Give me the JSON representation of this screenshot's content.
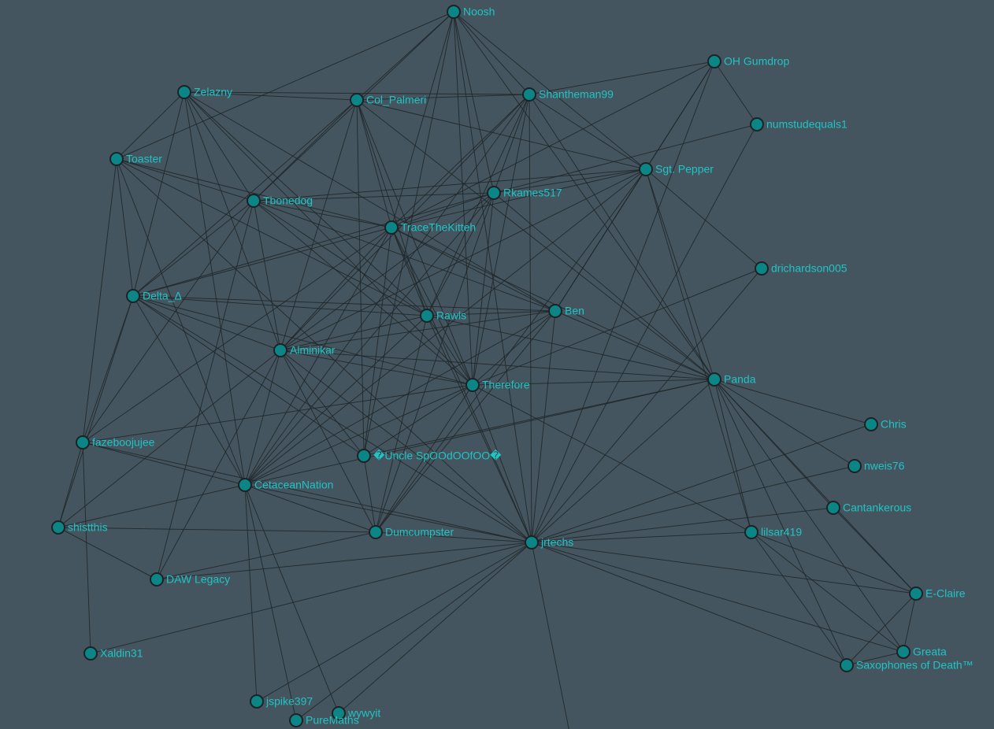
{
  "graph": {
    "node_color": "#0b8585",
    "label_color": "#1fc4c4",
    "edge_color": "#1e2628",
    "background": "#45555f",
    "nodes": [
      {
        "id": "Noosh",
        "label": "Noosh"
      },
      {
        "id": "OH Gumdrop",
        "label": "OH Gumdrop"
      },
      {
        "id": "numstudequals1",
        "label": "numstudequals1"
      },
      {
        "id": "Zelazny",
        "label": "Zelazny"
      },
      {
        "id": "Col_Palmeri",
        "label": "Col_Palmeri"
      },
      {
        "id": "Shantheman99",
        "label": "Shantheman99"
      },
      {
        "id": "Toaster",
        "label": "Toaster"
      },
      {
        "id": "Sgt. Pepper",
        "label": "Sgt. Pepper"
      },
      {
        "id": "Tbonedog",
        "label": "Tbonedog"
      },
      {
        "id": "Rkames517",
        "label": "Rkames517"
      },
      {
        "id": "TraceTheKitteh",
        "label": "TraceTheKitteh"
      },
      {
        "id": "drichardson005",
        "label": "drichardson005"
      },
      {
        "id": "Delta_Δ",
        "label": "Delta_Δ"
      },
      {
        "id": "Rawls",
        "label": "Rawls"
      },
      {
        "id": "Ben",
        "label": "Ben"
      },
      {
        "id": "Alminikar",
        "label": "Alminikar"
      },
      {
        "id": "Panda",
        "label": "Panda"
      },
      {
        "id": "Therefore",
        "label": "Therefore"
      },
      {
        "id": "Chris",
        "label": "Chris"
      },
      {
        "id": "fazeboojujee",
        "label": "fazeboojujee"
      },
      {
        "id": "Uncle SpOOdOOfOO",
        "label": "�Uncle SpOOdOOfOO�"
      },
      {
        "id": "nweis76",
        "label": "nweis76"
      },
      {
        "id": "CetaceanNation",
        "label": "CetaceanNation"
      },
      {
        "id": "Cantankerous",
        "label": "Cantankerous"
      },
      {
        "id": "shistthis",
        "label": "shistthis"
      },
      {
        "id": "Dumcumpster",
        "label": "Dumcumpster"
      },
      {
        "id": "lilsar419",
        "label": "lilsar419"
      },
      {
        "id": "jrtechs",
        "label": "jrtechs"
      },
      {
        "id": "DAW Legacy",
        "label": "DAW Legacy"
      },
      {
        "id": "E-Claire",
        "label": "E-Claire"
      },
      {
        "id": "Xaldin31",
        "label": "Xaldin31"
      },
      {
        "id": "Greata",
        "label": "Greata"
      },
      {
        "id": "Saxophones of Death™",
        "label": "Saxophones of Death™"
      },
      {
        "id": "jspike397",
        "label": "jspike397"
      },
      {
        "id": "wywyit",
        "label": "wywyit"
      },
      {
        "id": "PureMaths",
        "label": "PureMaths"
      }
    ],
    "edges": [
      [
        "Noosh",
        "Toaster"
      ],
      [
        "Noosh",
        "Col_Palmeri"
      ],
      [
        "Noosh",
        "Shantheman99"
      ],
      [
        "Noosh",
        "Sgt. Pepper"
      ],
      [
        "Noosh",
        "Rkames517"
      ],
      [
        "Noosh",
        "TraceTheKitteh"
      ],
      [
        "Noosh",
        "Therefore"
      ],
      [
        "Noosh",
        "Panda"
      ],
      [
        "Noosh",
        "jrtechs"
      ],
      [
        "Noosh",
        "Uncle SpOOdOOfOO"
      ],
      [
        "Noosh",
        "Tbonedog"
      ],
      [
        "OH Gumdrop",
        "Shantheman99"
      ],
      [
        "OH Gumdrop",
        "numstudequals1"
      ],
      [
        "OH Gumdrop",
        "Sgt. Pepper"
      ],
      [
        "OH Gumdrop",
        "TraceTheKitteh"
      ],
      [
        "OH Gumdrop",
        "Ben"
      ],
      [
        "OH Gumdrop",
        "jrtechs"
      ],
      [
        "numstudequals1",
        "Rkames517"
      ],
      [
        "numstudequals1",
        "jrtechs"
      ],
      [
        "Zelazny",
        "Col_Palmeri"
      ],
      [
        "Zelazny",
        "Shantheman99"
      ],
      [
        "Zelazny",
        "Toaster"
      ],
      [
        "Zelazny",
        "Tbonedog"
      ],
      [
        "Zelazny",
        "Delta_Δ"
      ],
      [
        "Zelazny",
        "Rawls"
      ],
      [
        "Zelazny",
        "Alminikar"
      ],
      [
        "Zelazny",
        "Therefore"
      ],
      [
        "Zelazny",
        "CetaceanNation"
      ],
      [
        "Zelazny",
        "Ben"
      ],
      [
        "Col_Palmeri",
        "Shantheman99"
      ],
      [
        "Col_Palmeri",
        "Sgt. Pepper"
      ],
      [
        "Col_Palmeri",
        "Tbonedog"
      ],
      [
        "Col_Palmeri",
        "TraceTheKitteh"
      ],
      [
        "Col_Palmeri",
        "Rawls"
      ],
      [
        "Col_Palmeri",
        "Alminikar"
      ],
      [
        "Col_Palmeri",
        "Therefore"
      ],
      [
        "Col_Palmeri",
        "Uncle SpOOdOOfOO"
      ],
      [
        "Col_Palmeri",
        "Panda"
      ],
      [
        "Col_Palmeri",
        "Delta_Δ"
      ],
      [
        "Shantheman99",
        "Sgt. Pepper"
      ],
      [
        "Shantheman99",
        "Rkames517"
      ],
      [
        "Shantheman99",
        "TraceTheKitteh"
      ],
      [
        "Shantheman99",
        "Panda"
      ],
      [
        "Shantheman99",
        "jrtechs"
      ],
      [
        "Shantheman99",
        "Alminikar"
      ],
      [
        "Shantheman99",
        "CetaceanNation"
      ],
      [
        "Shantheman99",
        "Therefore"
      ],
      [
        "Shantheman99",
        "Rawls"
      ],
      [
        "Toaster",
        "Tbonedog"
      ],
      [
        "Toaster",
        "TraceTheKitteh"
      ],
      [
        "Toaster",
        "Delta_Δ"
      ],
      [
        "Toaster",
        "CetaceanNation"
      ],
      [
        "Toaster",
        "Rawls"
      ],
      [
        "Toaster",
        "fazeboojujee"
      ],
      [
        "Toaster",
        "jrtechs"
      ],
      [
        "Sgt. Pepper",
        "Rkames517"
      ],
      [
        "Sgt. Pepper",
        "TraceTheKitteh"
      ],
      [
        "Sgt. Pepper",
        "Tbonedog"
      ],
      [
        "Sgt. Pepper",
        "drichardson005"
      ],
      [
        "Sgt. Pepper",
        "Ben"
      ],
      [
        "Sgt. Pepper",
        "Panda"
      ],
      [
        "Sgt. Pepper",
        "lilsar419"
      ],
      [
        "Sgt. Pepper",
        "CetaceanNation"
      ],
      [
        "Sgt. Pepper",
        "Alminikar"
      ],
      [
        "Sgt. Pepper",
        "Dumcumpster"
      ],
      [
        "Tbonedog",
        "Rkames517"
      ],
      [
        "Tbonedog",
        "TraceTheKitteh"
      ],
      [
        "Tbonedog",
        "Delta_Δ"
      ],
      [
        "Tbonedog",
        "Rawls"
      ],
      [
        "Tbonedog",
        "Ben"
      ],
      [
        "Tbonedog",
        "Alminikar"
      ],
      [
        "Tbonedog",
        "DAW Legacy"
      ],
      [
        "Tbonedog",
        "Therefore"
      ],
      [
        "Tbonedog",
        "fazeboojujee"
      ],
      [
        "Rkames517",
        "TraceTheKitteh"
      ],
      [
        "Rkames517",
        "Rawls"
      ],
      [
        "Rkames517",
        "Therefore"
      ],
      [
        "Rkames517",
        "Panda"
      ],
      [
        "Rkames517",
        "CetaceanNation"
      ],
      [
        "Rkames517",
        "Dumcumpster"
      ],
      [
        "Rkames517",
        "Alminikar"
      ],
      [
        "Rkames517",
        "Delta_Δ"
      ],
      [
        "TraceTheKitteh",
        "Delta_Δ"
      ],
      [
        "TraceTheKitteh",
        "Rawls"
      ],
      [
        "TraceTheKitteh",
        "Ben"
      ],
      [
        "TraceTheKitteh",
        "Therefore"
      ],
      [
        "TraceTheKitteh",
        "Alminikar"
      ],
      [
        "TraceTheKitteh",
        "CetaceanNation"
      ],
      [
        "TraceTheKitteh",
        "Uncle SpOOdOOfOO"
      ],
      [
        "TraceTheKitteh",
        "Panda"
      ],
      [
        "TraceTheKitteh",
        "fazeboojujee"
      ],
      [
        "TraceTheKitteh",
        "jrtechs"
      ],
      [
        "drichardson005",
        "Therefore"
      ],
      [
        "drichardson005",
        "jrtechs"
      ],
      [
        "Delta_Δ",
        "Rawls"
      ],
      [
        "Delta_Δ",
        "Ben"
      ],
      [
        "Delta_Δ",
        "Alminikar"
      ],
      [
        "Delta_Δ",
        "fazeboojujee"
      ],
      [
        "Delta_Δ",
        "CetaceanNation"
      ],
      [
        "Delta_Δ",
        "Uncle SpOOdOOfOO"
      ],
      [
        "Delta_Δ",
        "Therefore"
      ],
      [
        "Delta_Δ",
        "jrtechs"
      ],
      [
        "Rawls",
        "Ben"
      ],
      [
        "Rawls",
        "Therefore"
      ],
      [
        "Rawls",
        "Alminikar"
      ],
      [
        "Rawls",
        "CetaceanNation"
      ],
      [
        "Rawls",
        "Panda"
      ],
      [
        "Rawls",
        "Dumcumpster"
      ],
      [
        "Rawls",
        "jrtechs"
      ],
      [
        "Ben",
        "Panda"
      ],
      [
        "Ben",
        "Therefore"
      ],
      [
        "Ben",
        "CetaceanNation"
      ],
      [
        "Ben",
        "Alminikar"
      ],
      [
        "Ben",
        "Dumcumpster"
      ],
      [
        "Ben",
        "jrtechs"
      ],
      [
        "Alminikar",
        "Panda"
      ],
      [
        "Alminikar",
        "Therefore"
      ],
      [
        "Alminikar",
        "CetaceanNation"
      ],
      [
        "Alminikar",
        "Dumcumpster"
      ],
      [
        "Alminikar",
        "Uncle SpOOdOOfOO"
      ],
      [
        "Alminikar",
        "shistthis"
      ],
      [
        "Alminikar",
        "DAW Legacy"
      ],
      [
        "Alminikar",
        "jrtechs"
      ],
      [
        "Panda",
        "Therefore"
      ],
      [
        "Panda",
        "Chris"
      ],
      [
        "Panda",
        "nweis76"
      ],
      [
        "Panda",
        "Cantankerous"
      ],
      [
        "Panda",
        "lilsar419"
      ],
      [
        "Panda",
        "E-Claire"
      ],
      [
        "Panda",
        "Greata"
      ],
      [
        "Panda",
        "Saxophones of Death™"
      ],
      [
        "Panda",
        "CetaceanNation"
      ],
      [
        "Panda",
        "jrtechs"
      ],
      [
        "Therefore",
        "fazeboojujee"
      ],
      [
        "Therefore",
        "CetaceanNation"
      ],
      [
        "Therefore",
        "Dumcumpster"
      ],
      [
        "Therefore",
        "jrtechs"
      ],
      [
        "Therefore",
        "lilsar419"
      ],
      [
        "Therefore",
        "Uncle SpOOdOOfOO"
      ],
      [
        "Chris",
        "jrtechs"
      ],
      [
        "nweis76",
        "jrtechs"
      ],
      [
        "fazeboojujee",
        "CetaceanNation"
      ],
      [
        "fazeboojujee",
        "shistthis"
      ],
      [
        "fazeboojujee",
        "Xaldin31"
      ],
      [
        "fazeboojujee",
        "jrtechs"
      ],
      [
        "Uncle SpOOdOOfOO",
        "Dumcumpster"
      ],
      [
        "Uncle SpOOdOOfOO",
        "Panda"
      ],
      [
        "CetaceanNation",
        "shistthis"
      ],
      [
        "CetaceanNation",
        "Dumcumpster"
      ],
      [
        "CetaceanNation",
        "jrtechs"
      ],
      [
        "CetaceanNation",
        "jspike397"
      ],
      [
        "CetaceanNation",
        "PureMaths"
      ],
      [
        "CetaceanNation",
        "wywyit"
      ],
      [
        "Cantankerous",
        "jrtechs"
      ],
      [
        "Cantankerous",
        "E-Claire"
      ],
      [
        "shistthis",
        "Dumcumpster"
      ],
      [
        "shistthis",
        "DAW Legacy"
      ],
      [
        "shistthis",
        "Delta_Δ"
      ],
      [
        "Dumcumpster",
        "DAW Legacy"
      ],
      [
        "Dumcumpster",
        "jrtechs"
      ],
      [
        "lilsar419",
        "jrtechs"
      ],
      [
        "lilsar419",
        "E-Claire"
      ],
      [
        "lilsar419",
        "Greata"
      ],
      [
        "lilsar419",
        "Saxophones of Death™"
      ],
      [
        "jrtechs",
        "E-Claire"
      ],
      [
        "jrtechs",
        "Saxophones of Death™"
      ],
      [
        "jrtechs",
        "Greata"
      ],
      [
        "jrtechs",
        "DAW Legacy"
      ],
      [
        "jrtechs",
        "Xaldin31"
      ],
      [
        "jrtechs",
        "jspike397"
      ],
      [
        "jrtechs",
        "PureMaths"
      ],
      [
        "jrtechs",
        "wywyit"
      ],
      [
        "jrtechs",
        "offscreen"
      ],
      [
        "E-Claire",
        "Greata"
      ],
      [
        "E-Claire",
        "Saxophones of Death™"
      ],
      [
        "Greata",
        "Saxophones of Death™"
      ]
    ]
  }
}
